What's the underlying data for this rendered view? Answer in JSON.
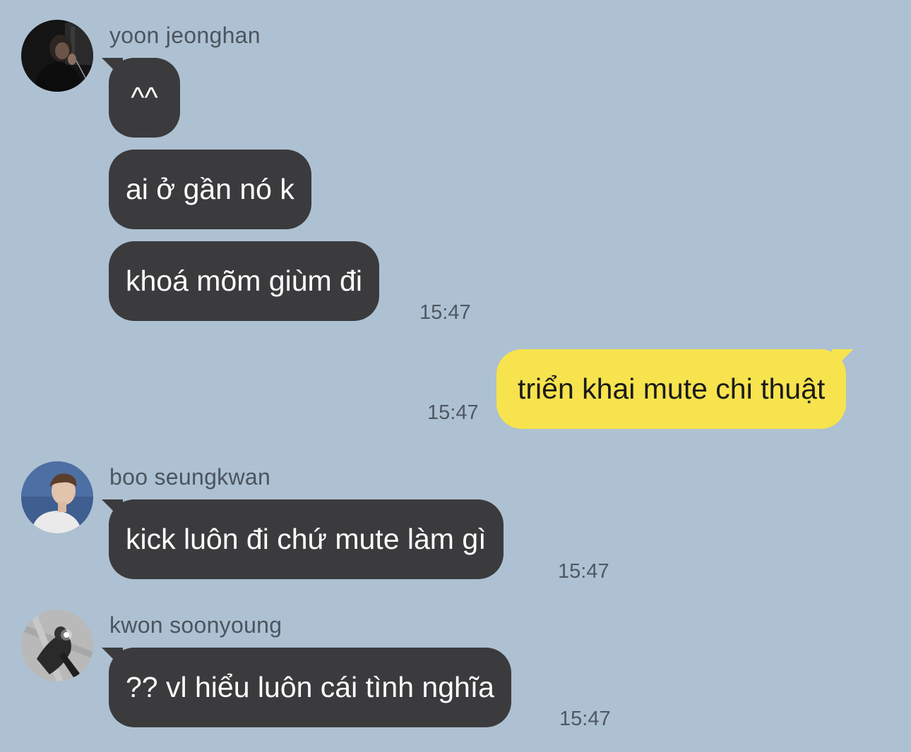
{
  "colors": {
    "background": "#adc1d2",
    "bubble_other": "#3b3b3d",
    "bubble_mine": "#f7e34d"
  },
  "messages": [
    {
      "sender": "yoon jeonghan",
      "avatar_icon": "profile-photo-dark",
      "bubbles": [
        "^^",
        "ai ở gần nó k",
        "khoá mõm giùm đi"
      ],
      "time": "15:47"
    },
    {
      "sender": "me",
      "bubbles": [
        "triển khai mute chi thuật"
      ],
      "time": "15:47"
    },
    {
      "sender": "boo seungkwan",
      "avatar_icon": "profile-photo-light",
      "bubbles": [
        "kick luôn đi chứ mute làm gì"
      ],
      "time": "15:47"
    },
    {
      "sender": "kwon soonyoung",
      "avatar_icon": "profile-photo-grey",
      "bubbles": [
        "?? vl hiểu luôn cái tình nghĩa"
      ],
      "time": "15:47"
    }
  ]
}
